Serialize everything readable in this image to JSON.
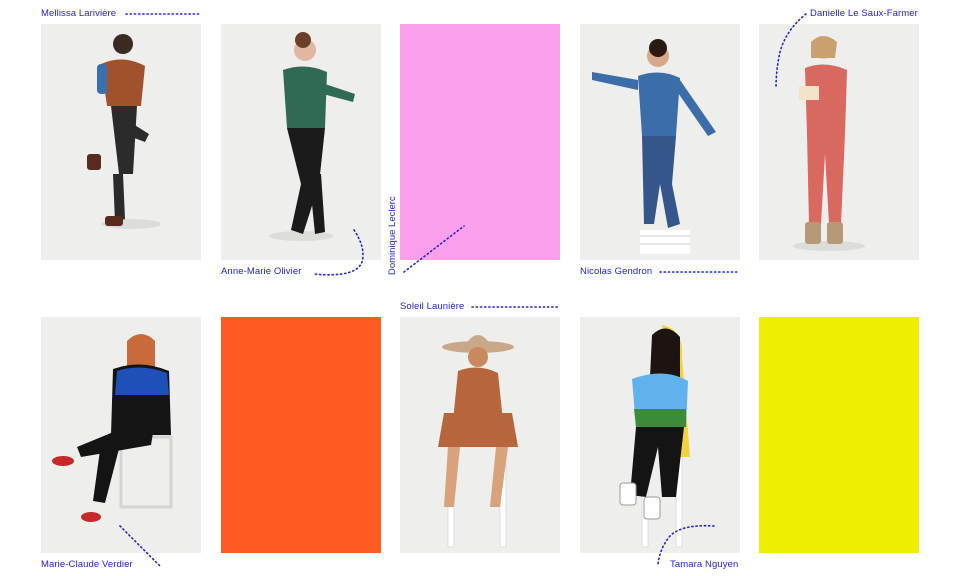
{
  "people": [
    {
      "name": "Mellissa Larivière",
      "kind": "photo"
    },
    {
      "name": "Anne-Marie Olivier",
      "kind": "photo"
    },
    {
      "name": "Dominique Leclerc",
      "kind": "color",
      "color": "#fa9fec"
    },
    {
      "name": "Nicolas Gendron",
      "kind": "photo"
    },
    {
      "name": "Danielle Le Saux-Farmer",
      "kind": "photo"
    },
    {
      "name": "Marie-Claude Verdier",
      "kind": "photo"
    },
    {
      "name": "",
      "kind": "color",
      "color": "#ff5a1f"
    },
    {
      "name": "Soleil Launière",
      "kind": "photo"
    },
    {
      "name": "Tamara Nguyen",
      "kind": "photo"
    },
    {
      "name": "",
      "kind": "color",
      "color": "#eeee00"
    }
  ],
  "accent_color": "#2323c8"
}
